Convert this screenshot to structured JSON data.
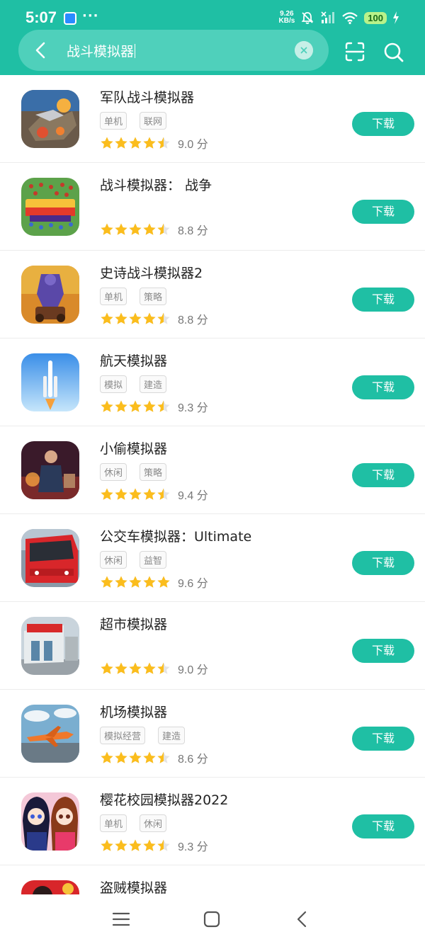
{
  "status": {
    "time": "5:07",
    "dots": "···",
    "net_speed_top": "9.26",
    "net_speed_bottom": "KB/s",
    "battery": "100"
  },
  "search": {
    "query": "战斗模拟器"
  },
  "icons": {
    "back": "chevron-left-icon",
    "clear": "close-icon",
    "scan": "scan-icon",
    "search": "search-icon",
    "star": "star-icon",
    "nav_menu": "menu-icon",
    "nav_home": "home-icon",
    "nav_back": "back-icon"
  },
  "colors": {
    "accent": "#1fbfa4",
    "star": "#fbbd1d"
  },
  "apps": [
    {
      "title": "军队战斗模拟器",
      "tags": [
        "单机",
        "联网"
      ],
      "score": "9.0 分",
      "stars": 4.5,
      "download": "下载"
    },
    {
      "title": "战斗模拟器：  战争",
      "tags": [],
      "score": "8.8 分",
      "stars": 4.5,
      "download": "下载"
    },
    {
      "title": "史诗战斗模拟器2",
      "tags": [
        "单机",
        "策略"
      ],
      "score": "8.8 分",
      "stars": 4.5,
      "download": "下载"
    },
    {
      "title": "航天模拟器",
      "tags": [
        "模拟",
        "建造"
      ],
      "score": "9.3 分",
      "stars": 4.5,
      "download": "下载"
    },
    {
      "title": "小偷模拟器",
      "tags": [
        "休闲",
        "策略"
      ],
      "score": "9.4 分",
      "stars": 4.5,
      "download": "下载"
    },
    {
      "title": "公交车模拟器：Ultimate",
      "tags": [
        "休闲",
        "益智"
      ],
      "score": "9.6 分",
      "stars": 5,
      "download": "下载"
    },
    {
      "title": "超市模拟器",
      "tags": [],
      "score": "9.0 分",
      "stars": 4.5,
      "download": "下载"
    },
    {
      "title": "机场模拟器",
      "tags": [
        "模拟经营",
        "建造"
      ],
      "score": "8.6 分",
      "stars": 4.5,
      "download": "下载"
    },
    {
      "title": "樱花校园模拟器2022",
      "tags": [
        "单机",
        "休闲"
      ],
      "score": "9.3 分",
      "stars": 4.5,
      "download": "下载"
    },
    {
      "title": "盗贼模拟器",
      "tags": [],
      "score": "",
      "stars": 0,
      "download": ""
    }
  ]
}
